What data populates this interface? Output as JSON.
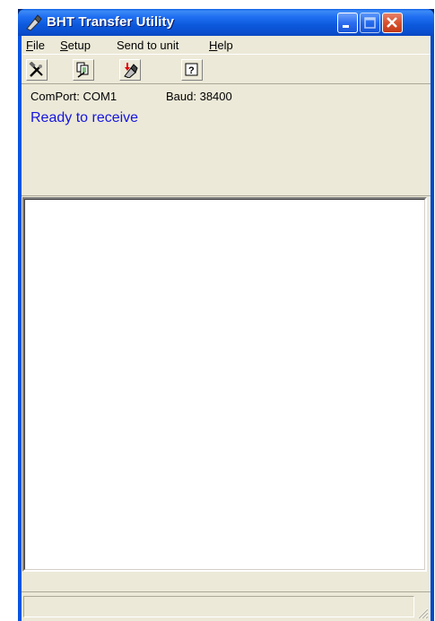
{
  "window": {
    "title": "BHT Transfer Utility"
  },
  "menu": [
    {
      "label": "File",
      "accel": "F",
      "rest": "ile"
    },
    {
      "label": "Setup",
      "accel": "S",
      "rest": "etup"
    },
    {
      "label": "Send to unit",
      "accel": "",
      "rest": "Send to unit"
    },
    {
      "label": "Help",
      "accel": "H",
      "rest": "elp"
    }
  ],
  "toolbar": {
    "icons": [
      "setup-tools-icon",
      "receive-file-icon",
      "send-to-unit-icon",
      "help-icon"
    ]
  },
  "info": {
    "comport": "ComPort: COM1",
    "baud": "Baud: 38400",
    "status": "Ready to receive",
    "status_color": "#1515e0"
  },
  "log": {
    "content": ""
  }
}
